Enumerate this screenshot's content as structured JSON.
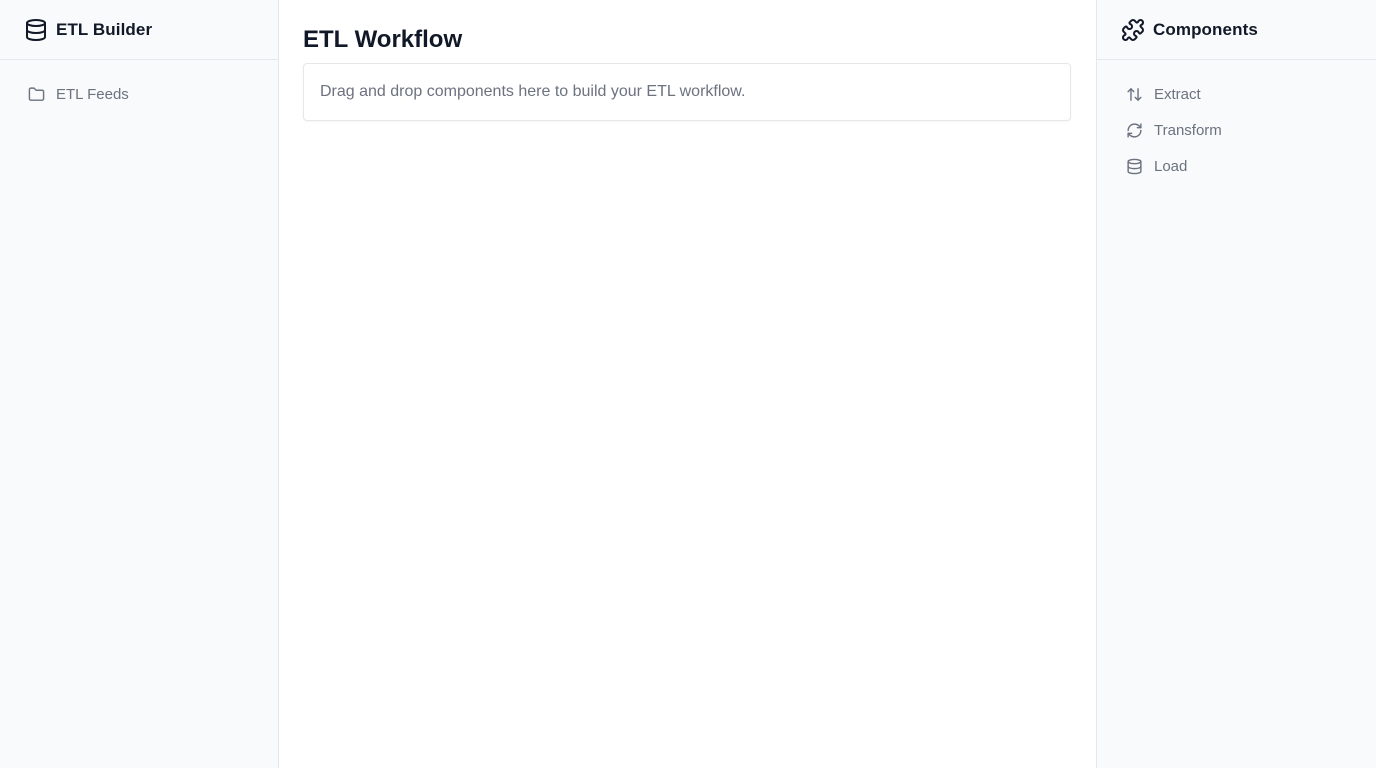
{
  "left_sidebar": {
    "title": "ETL Builder",
    "title_icon": "database-icon",
    "items": [
      {
        "label": "ETL Feeds",
        "icon": "folder-icon"
      }
    ]
  },
  "main": {
    "title": "ETL Workflow",
    "dropzone_text": "Drag and drop components here to build your ETL workflow."
  },
  "right_sidebar": {
    "title": "Components",
    "title_icon": "puzzle-icon",
    "items": [
      {
        "label": "Extract",
        "icon": "arrows-up-down-icon"
      },
      {
        "label": "Transform",
        "icon": "refresh-icon"
      },
      {
        "label": "Load",
        "icon": "database-icon"
      }
    ]
  },
  "colors": {
    "sidebar_bg": "#f9fafb",
    "border": "#e5e7eb",
    "muted_text": "#6b7280",
    "heading_text": "#111827"
  }
}
